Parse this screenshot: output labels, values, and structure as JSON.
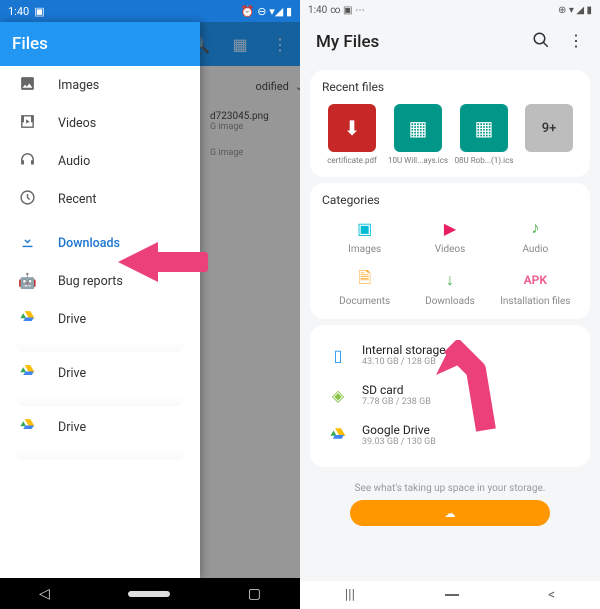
{
  "left": {
    "status": {
      "time": "1:40",
      "icons": "⏰ ⊖ ▾◢ ▮"
    },
    "app_title": "Files",
    "sort_label": "odified",
    "drawer": [
      {
        "icon": "image",
        "label": "Images"
      },
      {
        "icon": "video",
        "label": "Videos"
      },
      {
        "icon": "audio",
        "label": "Audio"
      },
      {
        "icon": "recent",
        "label": "Recent"
      },
      {
        "icon": "download",
        "label": "Downloads",
        "selected": true
      },
      {
        "icon": "bug",
        "label": "Bug reports"
      },
      {
        "icon": "drive",
        "label": "Drive"
      },
      {
        "icon": "drive",
        "label": "Drive"
      },
      {
        "icon": "drive",
        "label": "Drive"
      }
    ],
    "underlay_files": [
      {
        "name": "d723045.png",
        "type": "G image"
      },
      {
        "name": "",
        "type": "G image"
      }
    ]
  },
  "right": {
    "status": {
      "time": "1:40",
      "left_icons": "∞ ▣ ⋯",
      "right_icons": "⊕ ▾ ◢ ▮"
    },
    "title": "My Files",
    "recent_header": "Recent files",
    "recent": [
      {
        "name": "certificate.pdf",
        "kind": "pdf"
      },
      {
        "name": "10U Will...ays.ics",
        "kind": "ics"
      },
      {
        "name": "08U Rob...(1).ics",
        "kind": "ics"
      },
      {
        "name": "9+",
        "kind": "more"
      }
    ],
    "categories_header": "Categories",
    "categories": [
      {
        "id": "images",
        "label": "Images",
        "glyph": "▣"
      },
      {
        "id": "videos",
        "label": "Videos",
        "glyph": "▶"
      },
      {
        "id": "audio",
        "label": "Audio",
        "glyph": "♪"
      },
      {
        "id": "documents",
        "label": "Documents",
        "glyph": "🗎"
      },
      {
        "id": "downloads",
        "label": "Downloads",
        "glyph": "↓"
      },
      {
        "id": "apk",
        "label": "Installation files",
        "glyph": "APK"
      }
    ],
    "storage": [
      {
        "id": "internal",
        "name": "Internal storage",
        "size": "43.10 GB / 128 GB"
      },
      {
        "id": "sd",
        "name": "SD card",
        "size": "7.78 GB / 238 GB"
      },
      {
        "id": "gdrive",
        "name": "Google Drive",
        "size": "39.03 GB / 130 GB"
      }
    ],
    "footer_text": "See what's taking up space in your storage."
  }
}
